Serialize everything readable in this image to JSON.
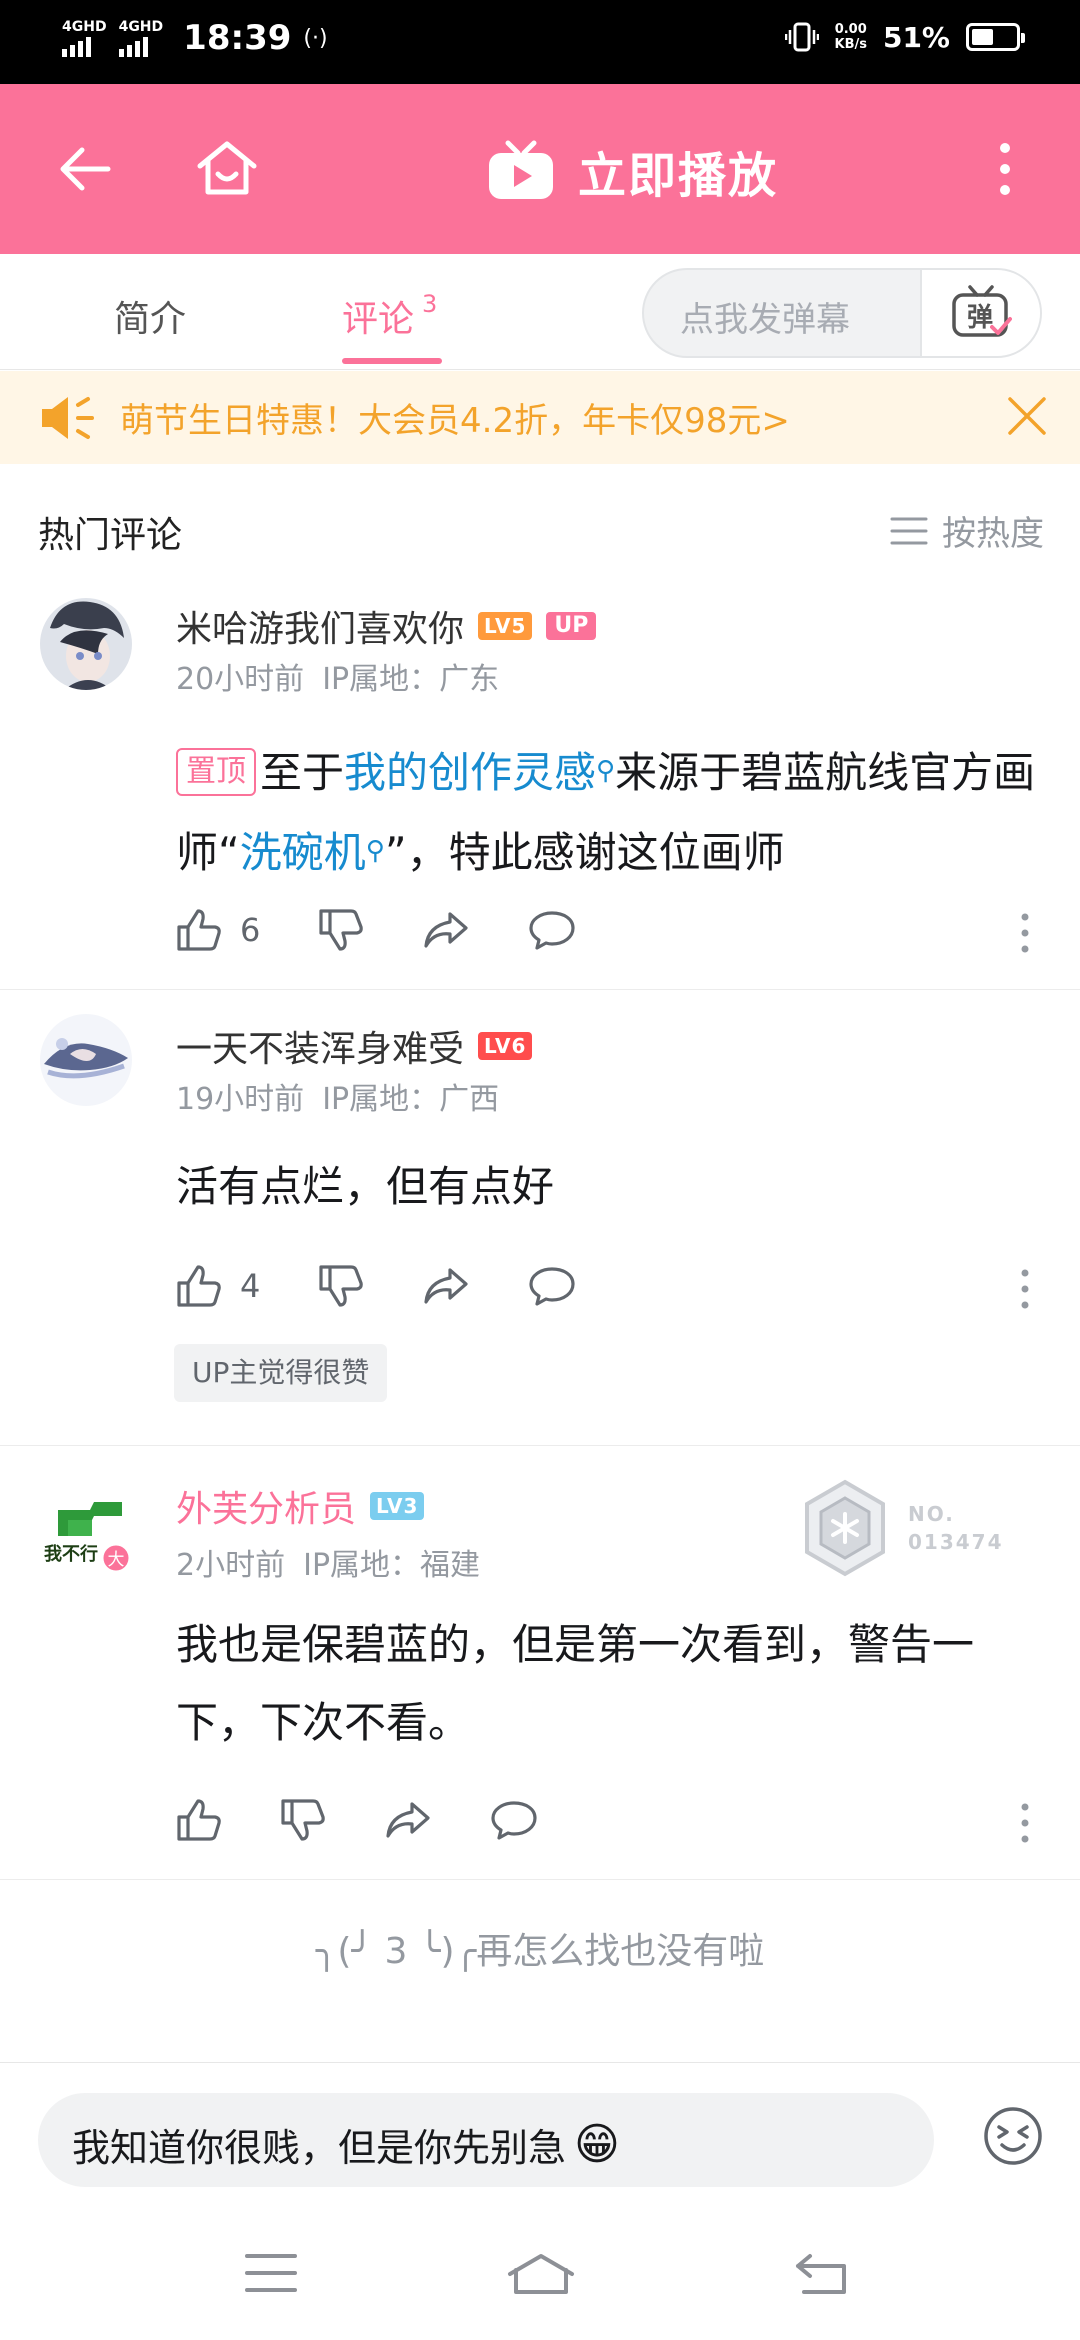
{
  "status_bar": {
    "sim1": "4GHD",
    "sim2": "4GHD",
    "time": "18:39",
    "hotspot": "(·)",
    "net_speed_value": "0.00",
    "net_speed_unit": "KB/s",
    "battery": "51%",
    "battery_level": 0.51
  },
  "topbar": {
    "play_label": "立即播放"
  },
  "tabs": {
    "intro": "简介",
    "comments": "评论",
    "comments_count": "3",
    "danmaku_placeholder": "点我发弹幕",
    "danmaku_icon_char": "弹"
  },
  "promo": {
    "text": "萌节生日特惠！大会员4.2折，年卡仅98元>"
  },
  "section": {
    "title": "热门评论",
    "sort_label": "按热度"
  },
  "comments": [
    {
      "username": "米哈游我们喜欢你",
      "level": "LV5",
      "up_badge": "UP",
      "time": "20小时前",
      "ip": "IP属地：广东",
      "pin_label": "置顶",
      "text_part1": "至于",
      "link1": "我的创作灵感",
      "text_part2": "来源于碧蓝航线官方画师“",
      "link2": "洗碗机",
      "text_part3": "”，特此感谢这位画师",
      "likes": "6"
    },
    {
      "username": "一天不装浑身难受",
      "level": "LV6",
      "time": "19小时前",
      "ip": "IP属地：广西",
      "text": "活有点烂，但有点好",
      "likes": "4",
      "up_liked": "UP主觉得很赞"
    },
    {
      "username": "外芙分析员",
      "level": "LV3",
      "time": "2小时前",
      "ip": "IP属地：福建",
      "avatar_text": "我不行",
      "avatar_badge": "大",
      "medal_line1": "NO.",
      "medal_line2": "013474",
      "text": "我也是保碧蓝的，但是第一次看到，警告一下，下次不看。"
    }
  ],
  "end_text": "╮(╯ 3 ╰)╭再怎么找也没有啦",
  "input": {
    "text": "我知道你很贱，但是你先别急",
    "emoji": "😁"
  },
  "colors": {
    "brand_pink": "#fb7299",
    "link_blue": "#178bcf",
    "promo_orange": "#f3a32b"
  }
}
